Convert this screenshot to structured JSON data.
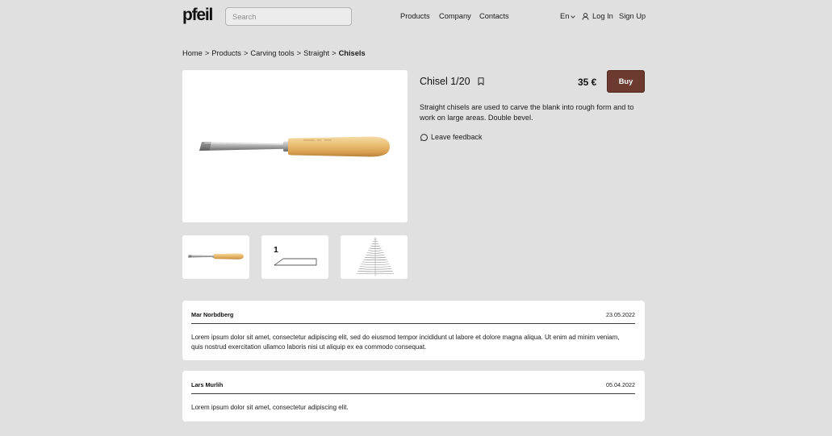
{
  "colors": {
    "background": "#e0e0e0",
    "surface": "#ffffff",
    "accent": "#6c3a2e",
    "text": "#1c1c1c"
  },
  "icons": {
    "language_menu": "chevron-down-icon",
    "login": "user-icon",
    "bookmark": "bookmark-icon",
    "feedback": "chat-bubble-icon"
  },
  "header": {
    "logo": "pfeil",
    "search": {
      "placeholder": "Search"
    },
    "nav": [
      {
        "label": "Products"
      },
      {
        "label": "Company"
      },
      {
        "label": "Contacts"
      }
    ],
    "language": "En",
    "login_label": "Log In",
    "signup_label": "Sign Up"
  },
  "breadcrumb": {
    "separator": ">",
    "items": [
      {
        "label": "Home"
      },
      {
        "label": "Products"
      },
      {
        "label": "Carving tools"
      },
      {
        "label": "Straight"
      },
      {
        "label": "Chisels"
      }
    ]
  },
  "product": {
    "title": "Chisel 1/20",
    "price": "35 €",
    "buy_label": "Buy",
    "description": "Straight chisels are used to carve the blank into rough form and to work on large areas. Double bevel.",
    "feedback_label": "Leave feedback",
    "profile_label": "1"
  },
  "reviews": [
    {
      "author": "Mar Norbdberg",
      "date": "23.05.2022",
      "text": "Lorem ipsum dolor sit amet, consectetur adipiscing elit, sed do eiusmod tempor incididunt ut labore et dolore magna aliqua. Ut enim ad minim veniam, quis nostrud exercitation ullamco laboris nisi ut aliquip ex ea commodo consequat."
    },
    {
      "author": "Lars Murlih",
      "date": "05.04.2022",
      "text": "Lorem ipsum dolor sit amet, consectetur adipiscing elit."
    }
  ]
}
